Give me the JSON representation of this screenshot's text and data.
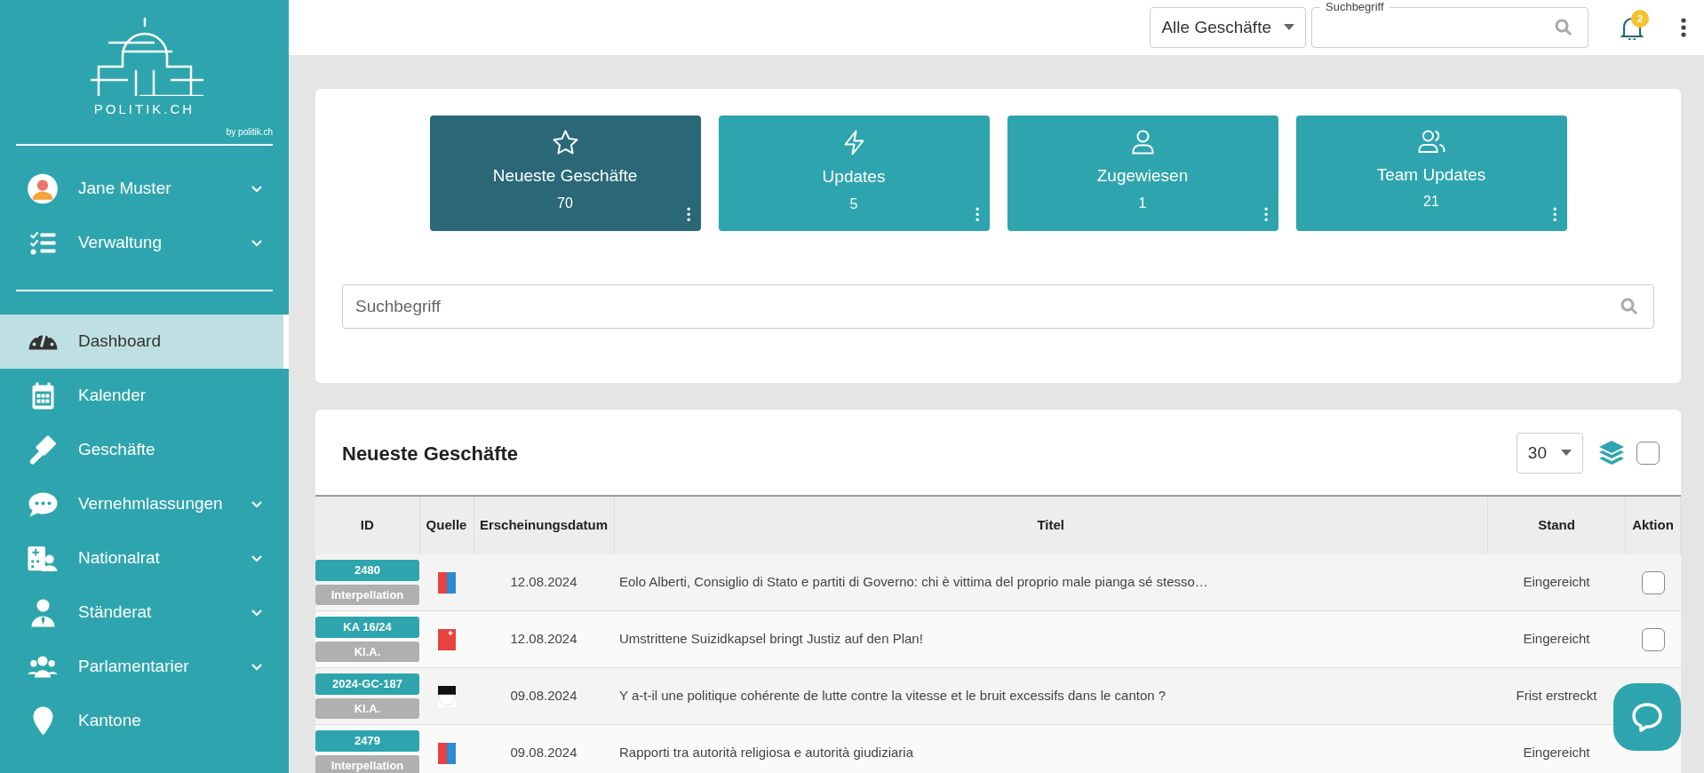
{
  "logo": {
    "name": "POLITIK.CH",
    "byline": "by politik.ch"
  },
  "user": {
    "name": "Jane Muster"
  },
  "sidebar": {
    "top_items": [
      {
        "label": "Verwaltung",
        "expandable": true
      }
    ],
    "items": [
      {
        "label": "Dashboard",
        "selected": true,
        "expandable": false
      },
      {
        "label": "Kalender",
        "selected": false,
        "expandable": false
      },
      {
        "label": "Geschäfte",
        "selected": false,
        "expandable": false
      },
      {
        "label": "Vernehmlassungen",
        "selected": false,
        "expandable": true
      },
      {
        "label": "Nationalrat",
        "selected": false,
        "expandable": true
      },
      {
        "label": "Ständerat",
        "selected": false,
        "expandable": true
      },
      {
        "label": "Parlamentarier",
        "selected": false,
        "expandable": true
      },
      {
        "label": "Kantone",
        "selected": false,
        "expandable": false
      }
    ]
  },
  "header": {
    "filter": "Alle Geschäfte",
    "search_label": "Suchbegriff",
    "notifications": "2"
  },
  "tiles": [
    {
      "label": "Neueste Geschäfte",
      "count": "70",
      "selected": true
    },
    {
      "label": "Updates",
      "count": "5",
      "selected": false
    },
    {
      "label": "Zugewiesen",
      "count": "1",
      "selected": false
    },
    {
      "label": "Team Updates",
      "count": "21",
      "selected": false
    }
  ],
  "search": {
    "placeholder": "Suchbegriff"
  },
  "table": {
    "title": "Neueste Geschäfte",
    "page_size": "30",
    "select_all": false,
    "columns": [
      "ID",
      "Quelle",
      "Erscheinungsdatum",
      "Titel",
      "Stand",
      "Aktion"
    ],
    "rows": [
      {
        "id": "2480",
        "type": "Interpellation",
        "source": {
          "kind": "vsplit"
        },
        "date": "12.08.2024",
        "title": "Eolo Alberti, Consiglio di Stato e partiti di Governo: chi è vittima del proprio male pianga sé stesso…",
        "status": "Eingereicht",
        "checked": false
      },
      {
        "id": "KA 16/24",
        "type": "Kl.A.",
        "source": {
          "kind": "cross"
        },
        "date": "12.08.2024",
        "title": "Umstrittene Suizidkapsel bringt Justiz auf den Plan!",
        "status": "Eingereicht",
        "checked": false
      },
      {
        "id": "2024-GC-187",
        "type": "Kl.A.",
        "source": {
          "kind": "hsplit"
        },
        "date": "09.08.2024",
        "title": "Y a-t-il une politique cohérente de lutte contre la vitesse et le bruit excessifs dans le canton ?",
        "status": "Frist erstreckt"
      },
      {
        "id": "2479",
        "type": "Interpellation",
        "source": {
          "kind": "vsplit"
        },
        "date": "09.08.2024",
        "title": "Rapporti tra autorità religiosa e autorità giudiziaria",
        "status": "Eingereicht"
      }
    ]
  }
}
